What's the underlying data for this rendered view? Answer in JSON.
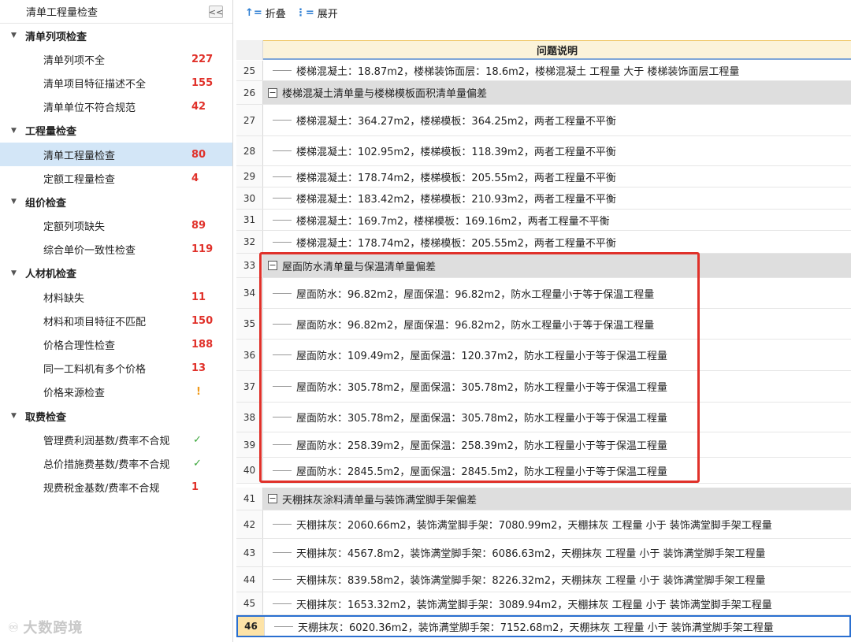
{
  "sidebar": {
    "title": "清单工程量检查",
    "collapse_label": "<<",
    "groups": [
      {
        "label": "清单列项检查",
        "items": [
          {
            "label": "清单列项不全",
            "count": "227",
            "type": "num"
          },
          {
            "label": "清单项目特征描述不全",
            "count": "155",
            "type": "num"
          },
          {
            "label": "清单单位不符合规范",
            "count": "42",
            "type": "num"
          }
        ]
      },
      {
        "label": "工程量检查",
        "items": [
          {
            "label": "清单工程量检查",
            "count": "80",
            "type": "num",
            "active": true
          },
          {
            "label": "定额工程量检查",
            "count": "4",
            "type": "num"
          }
        ]
      },
      {
        "label": "组价检查",
        "items": [
          {
            "label": "定额列项缺失",
            "count": "89",
            "type": "num"
          },
          {
            "label": "综合单价一致性检查",
            "count": "119",
            "type": "num"
          }
        ]
      },
      {
        "label": "人材机检查",
        "items": [
          {
            "label": "材料缺失",
            "count": "11",
            "type": "num"
          },
          {
            "label": "材料和项目特征不匹配",
            "count": "150",
            "type": "num"
          },
          {
            "label": "价格合理性检查",
            "count": "188",
            "type": "num"
          },
          {
            "label": "同一工料机有多个价格",
            "count": "13",
            "type": "num"
          },
          {
            "label": "价格来源检查",
            "count": "!",
            "type": "warn"
          }
        ]
      },
      {
        "label": "取费检查",
        "items": [
          {
            "label": "管理费利润基数/费率不合规",
            "count": "✓",
            "type": "ok"
          },
          {
            "label": "总价措施费基数/费率不合规",
            "count": "✓",
            "type": "ok"
          },
          {
            "label": "规费税金基数/费率不合规",
            "count": "1",
            "type": "num"
          }
        ]
      }
    ]
  },
  "watermark": "大数跨境",
  "toolbar": {
    "collapse_label": "折叠",
    "expand_label": "展开"
  },
  "table": {
    "header": "问题说明",
    "rows": [
      {
        "n": "25",
        "kind": "item",
        "text": "楼梯混凝土：18.87m2，楼梯装饰面层：18.6m2，楼梯混凝土 工程量 大于 楼梯装饰面层工程量"
      },
      {
        "n": "26",
        "kind": "group",
        "text": "楼梯混凝土清单量与楼梯模板面积清单量偏差"
      },
      {
        "n": "27",
        "kind": "item",
        "text": "楼梯混凝土：364.27m2，楼梯模板：364.25m2，两者工程量不平衡"
      },
      {
        "n": "28",
        "kind": "item",
        "text": "楼梯混凝土：102.95m2，楼梯模板：118.39m2，两者工程量不平衡"
      },
      {
        "n": "29",
        "kind": "item",
        "text": "楼梯混凝土：178.74m2，楼梯模板：205.55m2，两者工程量不平衡"
      },
      {
        "n": "30",
        "kind": "item",
        "text": "楼梯混凝土：183.42m2，楼梯模板：210.93m2，两者工程量不平衡"
      },
      {
        "n": "31",
        "kind": "item",
        "text": "楼梯混凝土：169.7m2，楼梯模板：169.16m2，两者工程量不平衡"
      },
      {
        "n": "32",
        "kind": "item",
        "text": "楼梯混凝土：178.74m2，楼梯模板：205.55m2，两者工程量不平衡"
      },
      {
        "n": "33",
        "kind": "group",
        "text": "屋面防水清单量与保温清单量偏差"
      },
      {
        "n": "34",
        "kind": "item",
        "text": "屋面防水：96.82m2，屋面保温：96.82m2，防水工程量小于等于保温工程量"
      },
      {
        "n": "35",
        "kind": "item",
        "text": "屋面防水：96.82m2，屋面保温：96.82m2，防水工程量小于等于保温工程量"
      },
      {
        "n": "36",
        "kind": "item",
        "text": "屋面防水：109.49m2，屋面保温：120.37m2，防水工程量小于等于保温工程量"
      },
      {
        "n": "37",
        "kind": "item",
        "text": "屋面防水：305.78m2，屋面保温：305.78m2，防水工程量小于等于保温工程量"
      },
      {
        "n": "38",
        "kind": "item",
        "text": "屋面防水：305.78m2，屋面保温：305.78m2，防水工程量小于等于保温工程量"
      },
      {
        "n": "39",
        "kind": "item",
        "text": "屋面防水：258.39m2，屋面保温：258.39m2，防水工程量小于等于保温工程量"
      },
      {
        "n": "40",
        "kind": "item",
        "text": "屋面防水：2845.5m2，屋面保温：2845.5m2，防水工程量小于等于保温工程量"
      },
      {
        "n": "41",
        "kind": "group",
        "text": "天棚抹灰涂料清单量与装饰满堂脚手架偏差"
      },
      {
        "n": "42",
        "kind": "item",
        "text": "天棚抹灰：2060.66m2，装饰满堂脚手架：7080.99m2，天棚抹灰 工程量 小于 装饰满堂脚手架工程量"
      },
      {
        "n": "43",
        "kind": "item",
        "text": "天棚抹灰：4567.8m2，装饰满堂脚手架：6086.63m2，天棚抹灰 工程量 小于 装饰满堂脚手架工程量"
      },
      {
        "n": "44",
        "kind": "item",
        "text": "天棚抹灰：839.58m2，装饰满堂脚手架：8226.32m2，天棚抹灰 工程量 小于 装饰满堂脚手架工程量"
      },
      {
        "n": "45",
        "kind": "item",
        "text": "天棚抹灰：1653.32m2，装饰满堂脚手架：3089.94m2，天棚抹灰 工程量 小于 装饰满堂脚手架工程量"
      },
      {
        "n": "46",
        "kind": "item",
        "text": "天棚抹灰：6020.36m2，装饰满堂脚手架：7152.68m2，天棚抹灰 工程量 小于 装饰满堂脚手架工程量",
        "selected": true
      }
    ]
  },
  "colors": {
    "accent": "#2a6fd0",
    "error_count": "#e0312a",
    "highlight_box": "#e0312a",
    "active_item": "#d3e6f7",
    "group_row": "#dedede"
  }
}
